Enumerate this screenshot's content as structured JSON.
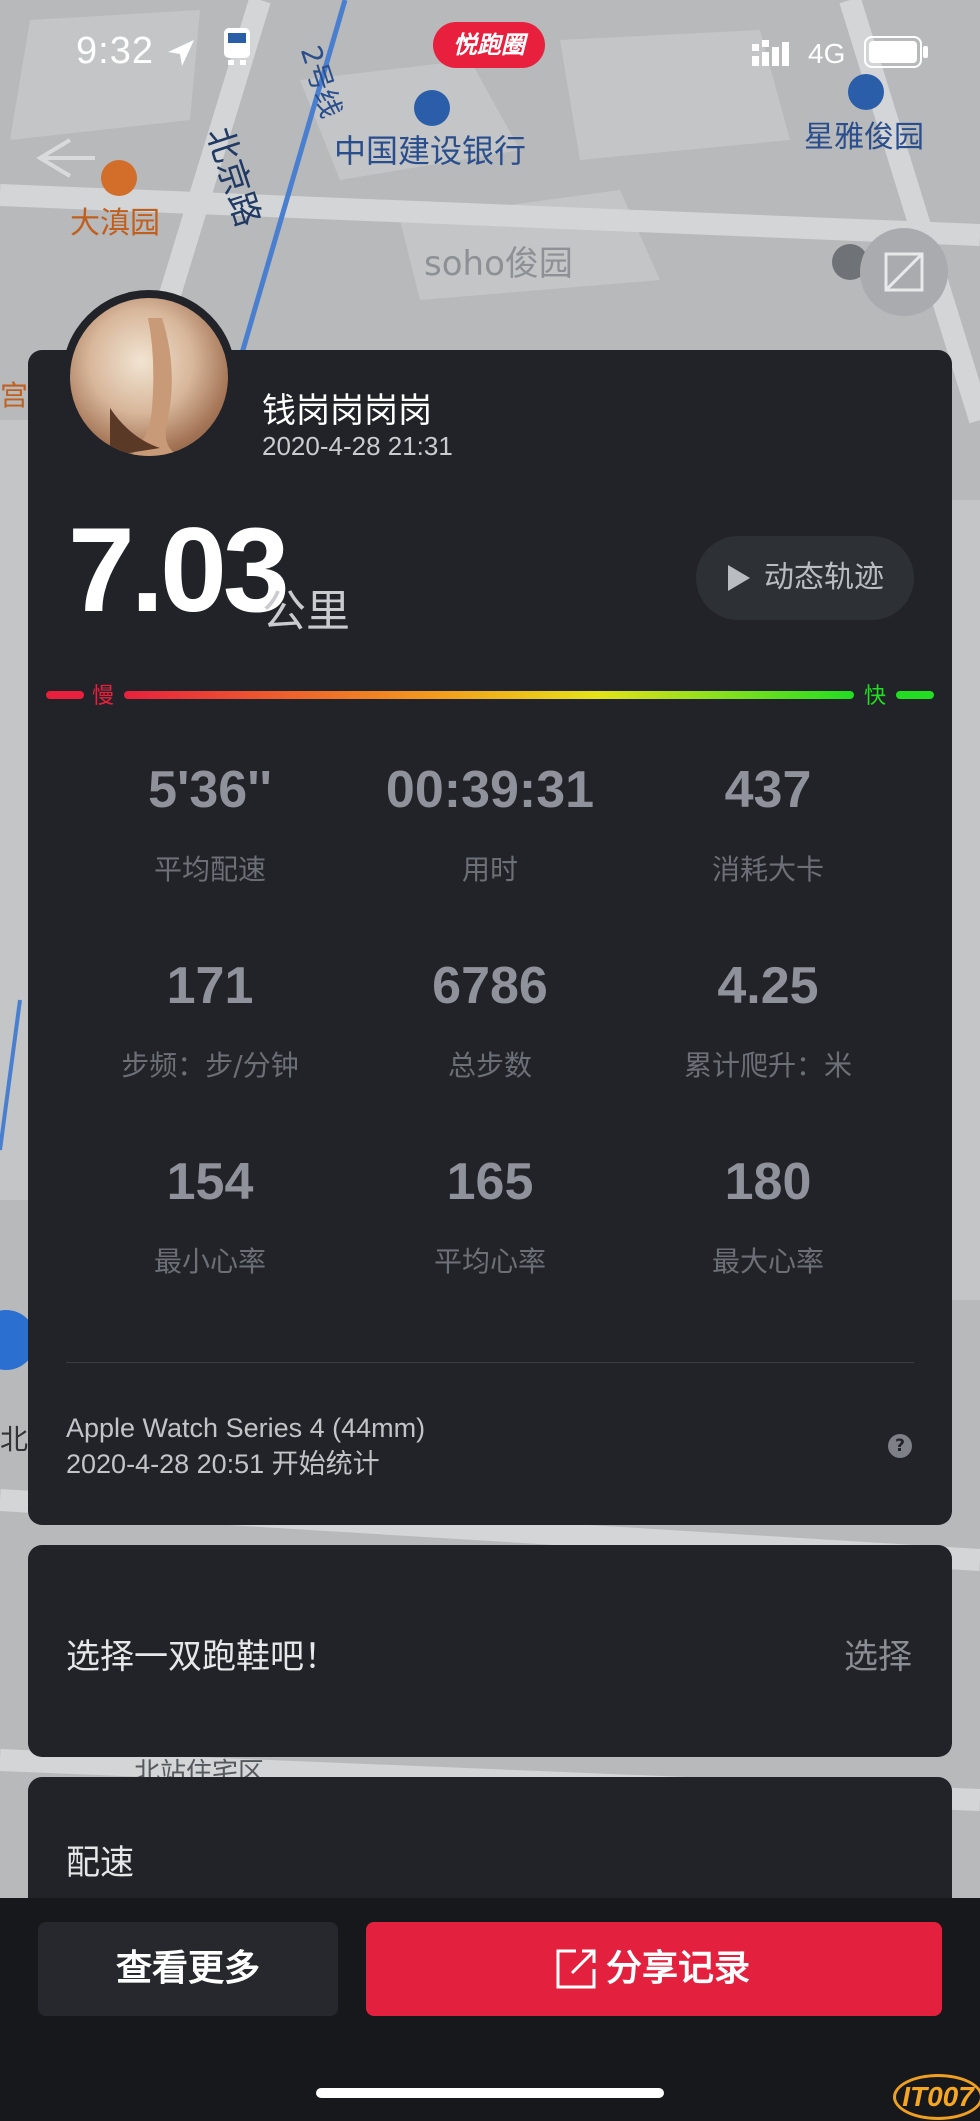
{
  "status_bar": {
    "time": "9:32",
    "brand": "悦跑圈",
    "network": "4G"
  },
  "map": {
    "labels": {
      "beijing_road": "北京路",
      "line2": "2号线",
      "ccb": "中国建设银行",
      "xingya": "星雅俊园",
      "dadian": "大滇园",
      "soho": "soho俊园",
      "gong": "宫",
      "bei": "北",
      "beizhan": "北站住宅区"
    }
  },
  "summary": {
    "username": "钱岗岗岗岗",
    "datetime": "2020-4-28 21:31",
    "distance": "7.03",
    "unit": "公里",
    "track_button": "动态轨迹",
    "pace_scale": {
      "slow": "慢",
      "fast": "快"
    },
    "stats": [
      {
        "value": "5'36''",
        "label": "平均配速"
      },
      {
        "value": "00:39:31",
        "label": "用时"
      },
      {
        "value": "437",
        "label": "消耗大卡"
      },
      {
        "value": "171",
        "label": "步频：步/分钟"
      },
      {
        "value": "6786",
        "label": "总步数"
      },
      {
        "value": "4.25",
        "label": "累计爬升：米"
      },
      {
        "value": "154",
        "label": "最小心率"
      },
      {
        "value": "165",
        "label": "平均心率"
      },
      {
        "value": "180",
        "label": "最大心率"
      }
    ],
    "device": "Apple Watch Series 4 (44mm)",
    "start": "2020-4-28 20:51 开始统计",
    "help": "?"
  },
  "shoe": {
    "prompt": "选择一双跑鞋吧！",
    "action": "选择"
  },
  "pace_section": {
    "title": "配速"
  },
  "actions": {
    "more": "查看更多",
    "share": "分享记录"
  },
  "watermark": "IT007",
  "colors": {
    "card": "#212328",
    "accent": "#e3213f",
    "slow": "#e8203d",
    "fast": "#22dd22"
  }
}
